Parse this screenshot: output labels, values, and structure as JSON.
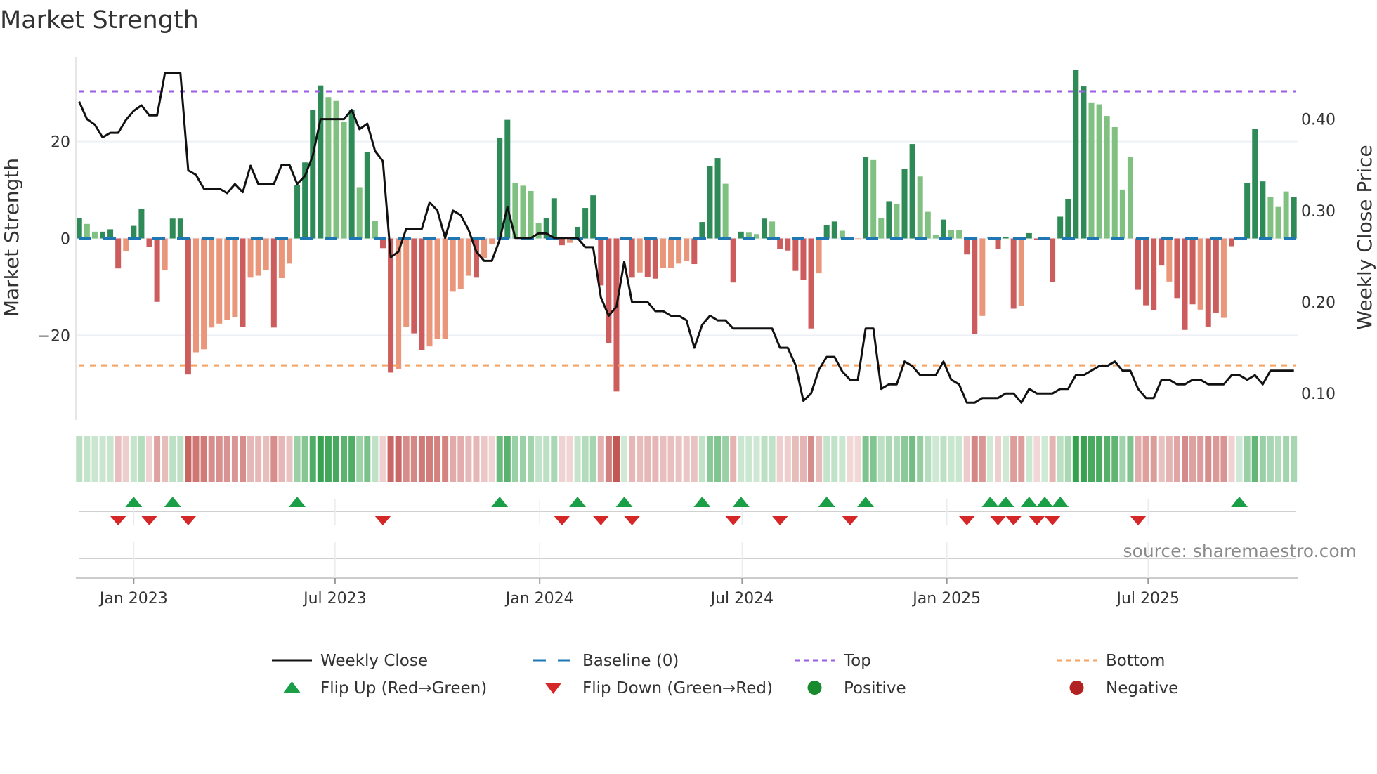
{
  "chart_data": {
    "type": "bar",
    "title": "Market Strength",
    "ylabel": "Market Strength",
    "ylabel_right": "Weekly Close Price",
    "ylim": [
      -37.5,
      37.5
    ],
    "ylim_right": [
      0.071,
      0.468
    ],
    "xlim": [
      "2022-11-10",
      "2025-11-13"
    ],
    "yticks": [
      {
        "value": 20,
        "label": "20"
      },
      {
        "value": 0,
        "label": "0"
      },
      {
        "value": -20,
        "label": "−20"
      }
    ],
    "yticks_right": [
      {
        "value": 0.4,
        "label": "0.40"
      },
      {
        "value": 0.3,
        "label": "0.30"
      },
      {
        "value": 0.2,
        "label": "0.20"
      },
      {
        "value": 0.1,
        "label": "0.10"
      }
    ],
    "xticks": [
      {
        "date": "2023-01-01",
        "label": "Jan 2023"
      },
      {
        "date": "2023-07-01",
        "label": "Jul 2023"
      },
      {
        "date": "2024-01-01",
        "label": "Jan 2024"
      },
      {
        "date": "2024-07-01",
        "label": "Jul 2024"
      },
      {
        "date": "2025-01-01",
        "label": "Jan 2025"
      },
      {
        "date": "2025-07-01",
        "label": "Jul 2025"
      }
    ],
    "grid": true,
    "top_level": 30.4,
    "bottom_level": -26.2,
    "baseline": 0,
    "dates": [
      "2022-11-13",
      "2022-11-20",
      "2022-11-27",
      "2022-12-04",
      "2022-12-11",
      "2022-12-18",
      "2022-12-25",
      "2023-01-01",
      "2023-01-08",
      "2023-01-15",
      "2023-01-22",
      "2023-01-29",
      "2023-02-05",
      "2023-02-12",
      "2023-02-19",
      "2023-02-26",
      "2023-03-05",
      "2023-03-12",
      "2023-03-19",
      "2023-03-26",
      "2023-04-02",
      "2023-04-09",
      "2023-04-16",
      "2023-04-23",
      "2023-04-30",
      "2023-05-07",
      "2023-05-14",
      "2023-05-21",
      "2023-05-28",
      "2023-06-04",
      "2023-06-11",
      "2023-06-18",
      "2023-06-25",
      "2023-07-02",
      "2023-07-09",
      "2023-07-16",
      "2023-07-23",
      "2023-07-30",
      "2023-08-06",
      "2023-08-13",
      "2023-08-20",
      "2023-08-27",
      "2023-09-03",
      "2023-09-10",
      "2023-09-17",
      "2023-09-24",
      "2023-10-01",
      "2023-10-08",
      "2023-10-15",
      "2023-10-22",
      "2023-10-29",
      "2023-11-05",
      "2023-11-12",
      "2023-11-19",
      "2023-11-26",
      "2023-12-03",
      "2023-12-10",
      "2023-12-17",
      "2023-12-24",
      "2023-12-31",
      "2024-01-07",
      "2024-01-14",
      "2024-01-21",
      "2024-01-28",
      "2024-02-04",
      "2024-02-11",
      "2024-02-18",
      "2024-02-25",
      "2024-03-03",
      "2024-03-10",
      "2024-03-17",
      "2024-03-24",
      "2024-03-31",
      "2024-04-07",
      "2024-04-14",
      "2024-04-21",
      "2024-04-28",
      "2024-05-05",
      "2024-05-12",
      "2024-05-19",
      "2024-05-26",
      "2024-06-02",
      "2024-06-09",
      "2024-06-16",
      "2024-06-23",
      "2024-06-30",
      "2024-07-07",
      "2024-07-14",
      "2024-07-21",
      "2024-07-28",
      "2024-08-04",
      "2024-08-11",
      "2024-08-18",
      "2024-08-25",
      "2024-09-01",
      "2024-09-08",
      "2024-09-15",
      "2024-09-22",
      "2024-09-29",
      "2024-10-06",
      "2024-10-13",
      "2024-10-20",
      "2024-10-27",
      "2024-11-03",
      "2024-11-10",
      "2024-11-17",
      "2024-11-24",
      "2024-12-01",
      "2024-12-08",
      "2024-12-15",
      "2024-12-22",
      "2024-12-29",
      "2025-01-05",
      "2025-01-12",
      "2025-01-19",
      "2025-01-26",
      "2025-02-02",
      "2025-02-09",
      "2025-02-16",
      "2025-02-23",
      "2025-03-02",
      "2025-03-09",
      "2025-03-16",
      "2025-03-23",
      "2025-03-30",
      "2025-04-06",
      "2025-04-13",
      "2025-04-20",
      "2025-04-27",
      "2025-05-04",
      "2025-05-11",
      "2025-05-18",
      "2025-05-25",
      "2025-06-01",
      "2025-06-08",
      "2025-06-15",
      "2025-06-22",
      "2025-06-29",
      "2025-07-06",
      "2025-07-13",
      "2025-07-20",
      "2025-07-27",
      "2025-08-03",
      "2025-08-10",
      "2025-08-17",
      "2025-08-24",
      "2025-08-31",
      "2025-09-07",
      "2025-09-14",
      "2025-09-21",
      "2025-09-28",
      "2025-10-05",
      "2025-10-12",
      "2025-10-19",
      "2025-10-26",
      "2025-11-02",
      "2025-11-09"
    ],
    "strength": [
      4.2,
      3.0,
      1.4,
      1.4,
      1.9,
      -6.2,
      -2.6,
      2.6,
      6.1,
      -1.7,
      -13.1,
      -6.6,
      4.1,
      4.1,
      -28.1,
      -23.5,
      -22.9,
      -18.4,
      -17.6,
      -16.8,
      -16.3,
      -18.3,
      -8.1,
      -7.7,
      -6.5,
      -18.4,
      -8.2,
      -5.2,
      11.1,
      15.7,
      26.5,
      31.6,
      29.2,
      28.4,
      24.1,
      26.6,
      10.6,
      17.9,
      3.6,
      -2.0,
      -27.7,
      -26.9,
      -18.3,
      -19.6,
      -23.1,
      -22.3,
      -20.8,
      -20.7,
      -11.0,
      -10.5,
      -7.7,
      -8.1,
      -4.1,
      -1.2,
      20.8,
      24.5,
      11.5,
      10.9,
      9.8,
      3.2,
      4.2,
      8.3,
      -1.4,
      -0.9,
      2.4,
      6.3,
      8.9,
      -9.7,
      -21.6,
      -31.6,
      0.3,
      -8.1,
      -7.0,
      -8.0,
      -8.3,
      -6.1,
      -6.1,
      -5.2,
      -4.6,
      -5.3,
      3.4,
      14.9,
      16.6,
      11.3,
      -9.1,
      1.4,
      1.2,
      0.9,
      4.1,
      3.5,
      -2.2,
      -2.5,
      -6.7,
      -8.6,
      -18.6,
      -7.2,
      2.8,
      3.5,
      1.6,
      -0.2,
      -0.1,
      16.9,
      16.2,
      4.2,
      7.7,
      7.1,
      14.3,
      19.5,
      12.8,
      5.5,
      0.8,
      3.9,
      1.7,
      1.7,
      -3.3,
      -19.7,
      -16.0,
      0.3,
      -2.2,
      0.3,
      -14.5,
      -13.9,
      1.1,
      -0.3,
      0.3,
      -9.0,
      4.5,
      8.1,
      34.8,
      31.4,
      28.1,
      27.7,
      25.3,
      23.0,
      10.1,
      16.8,
      -10.6,
      -13.8,
      -14.8,
      -5.6,
      -8.9,
      -12.3,
      -18.9,
      -13.6,
      -14.7,
      -18.2,
      -15.3,
      -16.4,
      -1.6,
      0.2,
      11.4,
      22.7,
      11.8,
      8.5,
      6.5,
      9.7,
      8.5
    ],
    "shade": "DLLDDDLDDDDLDDDLLLLLLDLLLDLLDDDDLLLDLDLDDLLDDLLLLLLDLLDDLLLLDDDLDDDDDDDDLDDLLLLDDDDLDDLLDLDDDDDLDDLDLDLLDLDDLLLDLLDDLDDDDLDDDDDDDDLLLLLLDDDDLDDDLDDLDLDDDLLLDL",
    "close": [
      0.419,
      0.4,
      0.394,
      0.38,
      0.385,
      0.385,
      0.399,
      0.409,
      0.415,
      0.404,
      0.404,
      0.45,
      0.45,
      0.45,
      0.344,
      0.339,
      0.324,
      0.324,
      0.324,
      0.319,
      0.329,
      0.32,
      0.349,
      0.329,
      0.329,
      0.329,
      0.35,
      0.35,
      0.329,
      0.338,
      0.36,
      0.4,
      0.4,
      0.4,
      0.4,
      0.41,
      0.389,
      0.395,
      0.365,
      0.354,
      0.249,
      0.255,
      0.28,
      0.28,
      0.28,
      0.309,
      0.3,
      0.27,
      0.3,
      0.295,
      0.279,
      0.255,
      0.245,
      0.245,
      0.268,
      0.304,
      0.27,
      0.27,
      0.27,
      0.275,
      0.275,
      0.27,
      0.27,
      0.27,
      0.27,
      0.26,
      0.26,
      0.205,
      0.185,
      0.195,
      0.244,
      0.2,
      0.2,
      0.2,
      0.19,
      0.19,
      0.185,
      0.185,
      0.18,
      0.15,
      0.175,
      0.185,
      0.18,
      0.18,
      0.171,
      0.171,
      0.171,
      0.171,
      0.171,
      0.171,
      0.15,
      0.15,
      0.131,
      0.092,
      0.1,
      0.126,
      0.14,
      0.14,
      0.124,
      0.115,
      0.115,
      0.171,
      0.171,
      0.105,
      0.11,
      0.11,
      0.135,
      0.13,
      0.12,
      0.12,
      0.12,
      0.135,
      0.115,
      0.11,
      0.09,
      0.09,
      0.095,
      0.095,
      0.095,
      0.1,
      0.1,
      0.09,
      0.105,
      0.1,
      0.1,
      0.1,
      0.105,
      0.105,
      0.12,
      0.12,
      0.125,
      0.13,
      0.13,
      0.135,
      0.125,
      0.125,
      0.105,
      0.095,
      0.095,
      0.115,
      0.115,
      0.11,
      0.11,
      0.115,
      0.115,
      0.11,
      0.11,
      0.11,
      0.12,
      0.12,
      0.115,
      0.12,
      0.11,
      0.125,
      0.125,
      0.125,
      0.125
    ],
    "legend": {
      "placement": "bottom",
      "entries": [
        {
          "label": "Weekly Close",
          "symbol": "line",
          "color": "#111111"
        },
        {
          "label": "Baseline (0)",
          "symbol": "dashed",
          "color": "#1f77b4"
        },
        {
          "label": "Top",
          "symbol": "dotted",
          "color": "#9b5de5"
        },
        {
          "label": "Bottom",
          "symbol": "dotted",
          "color": "#f4a261"
        },
        {
          "label": "Flip Up (Red→Green)",
          "symbol": "triangle-up",
          "color": "#1a9e46"
        },
        {
          "label": "Flip Down (Green→Red)",
          "symbol": "triangle-down",
          "color": "#d62728"
        },
        {
          "label": "Positive",
          "symbol": "circle",
          "color": "#1a8a2e"
        },
        {
          "label": "Negative",
          "symbol": "circle",
          "color": "#b22222"
        }
      ]
    },
    "colors": {
      "pos_dark": "#2e8b57",
      "pos_light": "#80c080",
      "neg_dark": "#cd5c5c",
      "neg_light": "#e9967a",
      "top": "#9b5de5",
      "bottom": "#f4a261",
      "baseline": "#1f77b4",
      "close": "#111111",
      "flip_up": "#1a9e46",
      "flip_down": "#d62728"
    },
    "source": "source: sharemaestro.com"
  }
}
